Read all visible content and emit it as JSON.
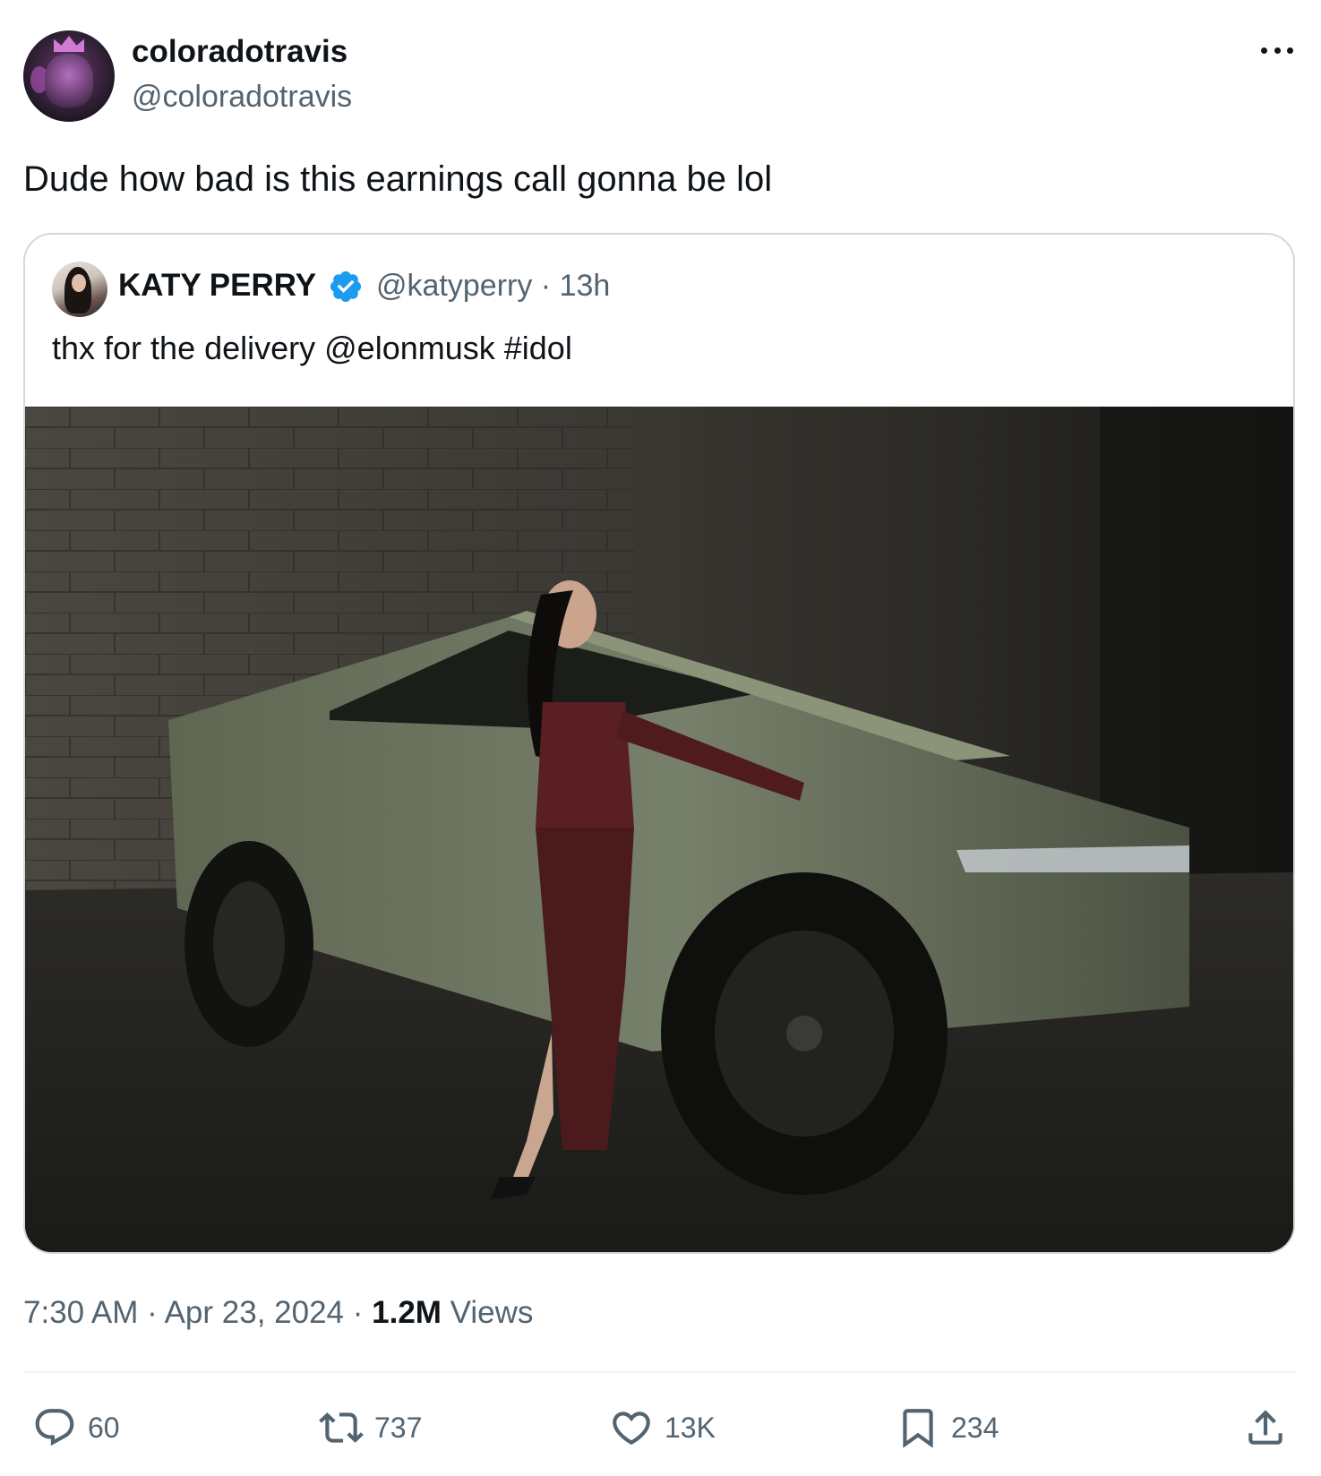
{
  "author": {
    "display_name": "coloradotravis",
    "handle": "@coloradotravis",
    "avatar_icon": "crowned-character-avatar"
  },
  "tweet": {
    "text": "Dude how bad is this earnings call gonna be lol"
  },
  "quoted": {
    "display_name": "KATY PERRY",
    "verified": true,
    "handle_time": "@katyperry · 13h",
    "text": "thx for the delivery @elonmusk #idol",
    "image_description_icon": "photo-woman-with-cybertruck"
  },
  "meta": {
    "time_date": "7:30 AM · Apr 23, 2024 · ",
    "views_count": "1.2M",
    "views_label": " Views"
  },
  "actions": {
    "replies": "60",
    "reposts": "737",
    "likes": "13K",
    "bookmarks": "234"
  },
  "colors": {
    "text_primary": "#0f1419",
    "text_secondary": "#536471",
    "verified_blue": "#1d9bf0",
    "border": "#cfd9de"
  }
}
